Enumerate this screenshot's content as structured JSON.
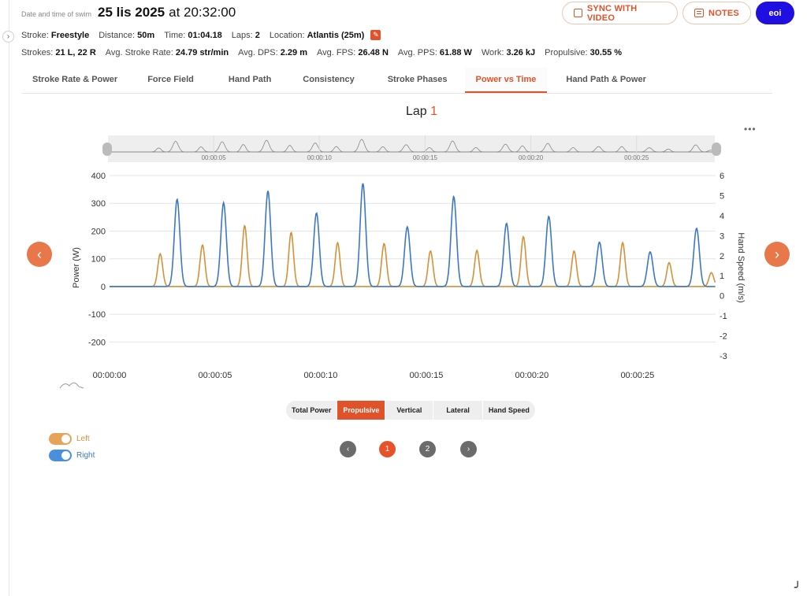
{
  "header": {
    "caption": "Date and time of swim",
    "date": "25 lis 2025",
    "at_time": "at 20:32:00",
    "sync_label": "SYNC WITH VIDEO",
    "notes_label": "NOTES",
    "user_label": "eoi"
  },
  "meta1": [
    {
      "label": "Stroke:",
      "value": "Freestyle"
    },
    {
      "label": "Distance:",
      "value": "50m"
    },
    {
      "label": "Time:",
      "value": "01:04.18"
    },
    {
      "label": "Laps:",
      "value": "2"
    },
    {
      "label": "Location:",
      "value": "Atlantis (25m)"
    }
  ],
  "meta2": [
    {
      "label": "Strokes:",
      "value": "21 L, 22 R"
    },
    {
      "label": "Avg. Stroke Rate:",
      "value": "24.79 str/min"
    },
    {
      "label": "Avg. DPS:",
      "value": "2.29 m"
    },
    {
      "label": "Avg. FPS:",
      "value": "26.48 N"
    },
    {
      "label": "Avg. PPS:",
      "value": "61.88 W"
    },
    {
      "label": "Work:",
      "value": "3.26 kJ"
    },
    {
      "label": "Propulsive:",
      "value": "30.55 %"
    }
  ],
  "tabs": [
    {
      "label": "Stroke Rate & Power",
      "active": false
    },
    {
      "label": "Force Field",
      "active": false
    },
    {
      "label": "Hand Path",
      "active": false
    },
    {
      "label": "Consistency",
      "active": false
    },
    {
      "label": "Stroke Phases",
      "active": false
    },
    {
      "label": "Power vs Time",
      "active": true
    },
    {
      "label": "Hand Path & Power",
      "active": false
    }
  ],
  "lap": {
    "prefix": "Lap",
    "number": "1"
  },
  "icons": {
    "more": "more-icon",
    "prev": "chevron-left-icon",
    "next": "chevron-right-icon",
    "edit": "edit-icon"
  },
  "colors": {
    "accent": "#e0522a",
    "left": "#d4913a",
    "right": "#3c78c0",
    "user": "#1f0fe0"
  },
  "chart_data": {
    "type": "line",
    "ylabel": "Power (W)",
    "y2label": "Hand Speed (m/s)",
    "ylim": [
      -250,
      400
    ],
    "y_ticks": [
      400,
      300,
      200,
      100,
      0,
      -100,
      -200
    ],
    "y2lim": [
      -3,
      6
    ],
    "y2_ticks": [
      6,
      5,
      4,
      3,
      2,
      1,
      0,
      -1,
      -2,
      -3
    ],
    "xlim": [
      0,
      28.7
    ],
    "x_ticks": [
      "00:00:00",
      "00:00:05",
      "00:00:10",
      "00:00:15",
      "00:00:20",
      "00:00:25"
    ],
    "x_tick_values": [
      0,
      5,
      10,
      15,
      20,
      25
    ],
    "grid": true,
    "navigator_ticks": [
      "00:00:05",
      "00:00:10",
      "00:00:15",
      "00:00:20",
      "00:00:25"
    ],
    "series": [
      {
        "name": "Left",
        "color": "#d4913a",
        "peaks": [
          [
            2.4,
            118
          ],
          [
            4.4,
            150
          ],
          [
            6.4,
            220
          ],
          [
            8.6,
            195
          ],
          [
            10.8,
            158
          ],
          [
            13.0,
            155
          ],
          [
            15.2,
            128
          ],
          [
            17.4,
            130
          ],
          [
            19.6,
            180
          ],
          [
            22.0,
            128
          ],
          [
            24.3,
            158
          ],
          [
            26.5,
            86
          ],
          [
            28.5,
            50
          ]
        ]
      },
      {
        "name": "Right",
        "color": "#3c78c0",
        "peaks": [
          [
            3.2,
            315
          ],
          [
            5.4,
            302
          ],
          [
            7.5,
            345
          ],
          [
            9.8,
            265
          ],
          [
            12.0,
            372
          ],
          [
            14.1,
            215
          ],
          [
            16.3,
            325
          ],
          [
            18.8,
            228
          ],
          [
            20.8,
            253
          ],
          [
            23.2,
            160
          ],
          [
            25.6,
            125
          ],
          [
            27.8,
            210
          ]
        ]
      }
    ]
  },
  "series_toggles": [
    "Total Power",
    "Propulsive",
    "Vertical",
    "Lateral",
    "Hand Speed"
  ],
  "active_toggle": "Propulsive",
  "legend": {
    "left": "Left",
    "right": "Right"
  },
  "pager": {
    "pages": [
      "1",
      "2"
    ],
    "current": "1"
  }
}
